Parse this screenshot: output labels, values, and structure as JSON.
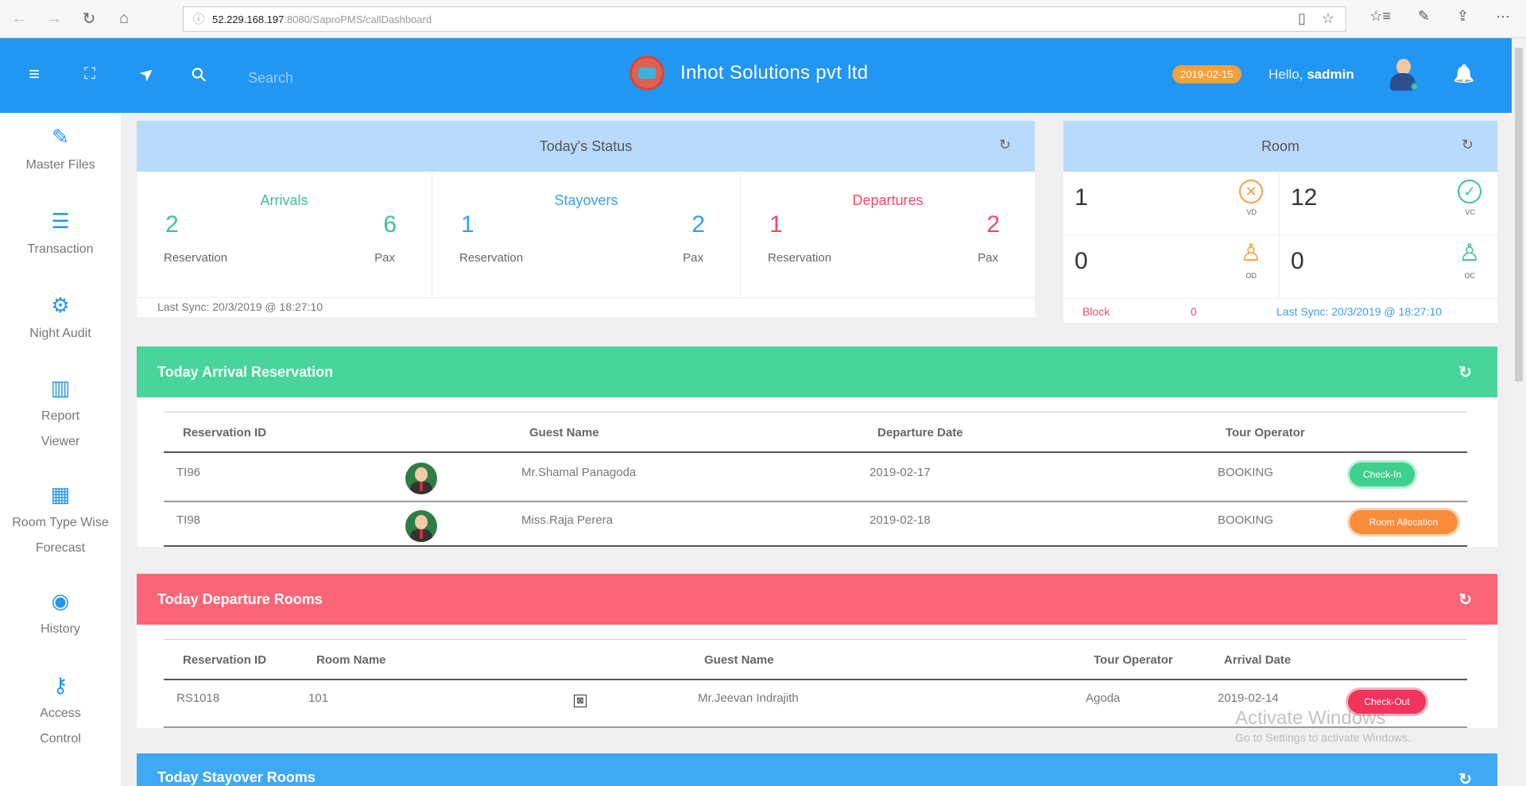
{
  "browser": {
    "back": "←",
    "forward": "→",
    "refresh": "↻",
    "home": "⌂",
    "info": "ⓘ",
    "url_host": "52.229.168.197",
    "url_path": ":8080/SaproPMS/callDashboard",
    "reading_view": "▯",
    "favorite": "☆",
    "favorites_bar": "☆≡",
    "notes": "✎",
    "share": "⇪",
    "more": "···"
  },
  "header": {
    "menu_icon": "≡",
    "fullscreen_icon": "⛶",
    "send_icon": "➤",
    "search_icon": "⚲",
    "search_placeholder": "Search",
    "company": "Inhot Solutions pvt ltd",
    "date": "2019-02-15",
    "hello_prefix": "Hello,",
    "username": "sadmin",
    "bell_icon": "🔔"
  },
  "sidebar": {
    "items": [
      {
        "icon": "✎",
        "label": "Master Files"
      },
      {
        "icon": "☰",
        "label": "Transaction"
      },
      {
        "icon": "⚙",
        "label": "Night Audit"
      },
      {
        "icon": "▥",
        "label": "Report Viewer"
      },
      {
        "icon": "▦",
        "label": "Room Type Wise Forecast"
      },
      {
        "icon": "◉",
        "label": "History"
      },
      {
        "icon": "⚷",
        "label": "Access Control"
      }
    ]
  },
  "status": {
    "title": "Today's Status",
    "refresh": "↻",
    "arrivals": {
      "title": "Arrivals",
      "reservation": "2",
      "pax": "6",
      "res_label": "Reservation",
      "pax_label": "Pax"
    },
    "stayovers": {
      "title": "Stayovers",
      "reservation": "1",
      "pax": "2",
      "res_label": "Reservation",
      "pax_label": "Pax"
    },
    "departures": {
      "title": "Departures",
      "reservation": "1",
      "pax": "2",
      "res_label": "Reservation",
      "pax_label": "Pax"
    },
    "sync": "Last Sync: 20/3/2019 @ 18:27:10"
  },
  "room": {
    "title": "Room",
    "refresh": "↻",
    "vd": {
      "value": "1",
      "icon": "✕",
      "label": "VD"
    },
    "vc": {
      "value": "12",
      "icon": "✓",
      "label": "VC"
    },
    "od": {
      "value": "0",
      "icon": "♙",
      "label": "OD"
    },
    "oc": {
      "value": "0",
      "icon": "♙",
      "label": "OC"
    },
    "block_label": "Block",
    "block_value": "0",
    "sync": "Last Sync: 20/3/2019 @ 18:27:10"
  },
  "arrival": {
    "title": "Today Arrival Reservation",
    "refresh": "↻",
    "headers": [
      "Reservation ID",
      "Guest Name",
      "Departure Date",
      "Tour Operator"
    ],
    "rows": [
      {
        "id": "TI96",
        "guest": "Mr.Shamal Panagoda",
        "departure": "2019-02-17",
        "operator": "BOOKING",
        "action": "Check-In"
      },
      {
        "id": "TI98",
        "guest": "Miss.Raja Perera",
        "departure": "2019-02-18",
        "operator": "BOOKING",
        "action": "Room Allocation"
      }
    ]
  },
  "departure": {
    "title": "Today Departure Rooms",
    "refresh": "↻",
    "headers": [
      "Reservation ID",
      "Room Name",
      "Guest Name",
      "Tour Operator",
      "Arrival Date"
    ],
    "rows": [
      {
        "id": "RS1018",
        "room": "101",
        "broken_img": "⊠",
        "guest": "Mr.Jeevan Indrajith",
        "operator": "Agoda",
        "arrival": "2019-02-14",
        "action": "Check-Out"
      }
    ]
  },
  "stayover": {
    "title": "Today Stayover Rooms",
    "refresh": "↻"
  },
  "watermark": {
    "line1": "Activate Windows",
    "line2": "Go to Settings to activate Windows."
  },
  "colors": {
    "header_blue": "#2196f3",
    "arrival_green": "#48d49a",
    "departure_red": "#fc6577",
    "stayover_blue": "#40a9f4",
    "arrivals_text": "#3cc48c",
    "stayovers_text": "#3a9ef0",
    "departures_text": "#f04a66"
  }
}
